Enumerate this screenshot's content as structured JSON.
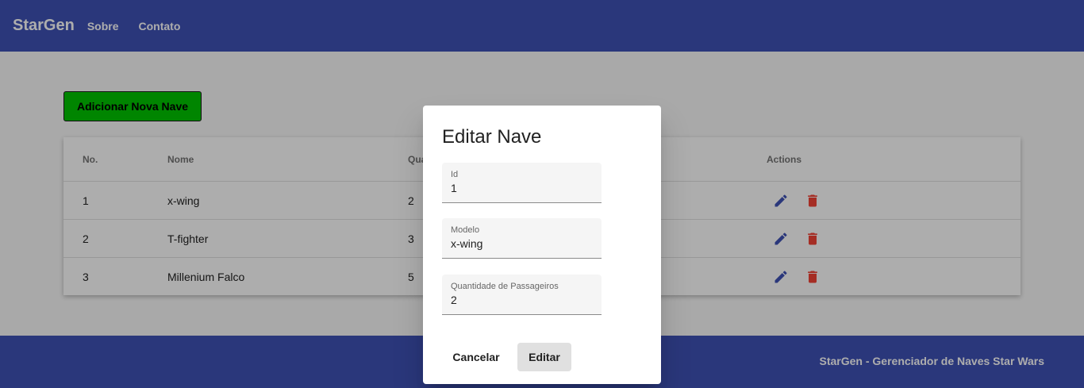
{
  "app": {
    "brand": "StarGen",
    "nav": [
      {
        "label": "Sobre"
      },
      {
        "label": "Contato"
      }
    ]
  },
  "main": {
    "add_button_label": "Adicionar Nova Nave",
    "table": {
      "headers": {
        "no": "No.",
        "nome": "Nome",
        "quantidade": "Qua",
        "actions": "Actions"
      },
      "rows": [
        {
          "no": "1",
          "nome": "x-wing",
          "quantidade": "2"
        },
        {
          "no": "2",
          "nome": "T-fighter",
          "quantidade": "3"
        },
        {
          "no": "3",
          "nome": "Millenium Falco",
          "quantidade": "5"
        }
      ],
      "edit_icon_color": "#3f51b5",
      "delete_icon_color": "#f44336"
    }
  },
  "footer": {
    "text": "StarGen - Gerenciador de Naves Star Wars"
  },
  "dialog": {
    "title": "Editar Nave",
    "fields": [
      {
        "label": "Id",
        "value": "1"
      },
      {
        "label": "Modelo",
        "value": "x-wing"
      },
      {
        "label": "Quantidade de Passageiros",
        "value": "2"
      }
    ],
    "cancel_label": "Cancelar",
    "submit_label": "Editar"
  },
  "colors": {
    "primary": "#3f51b5",
    "add_button": "#00c400",
    "delete": "#f44336"
  }
}
